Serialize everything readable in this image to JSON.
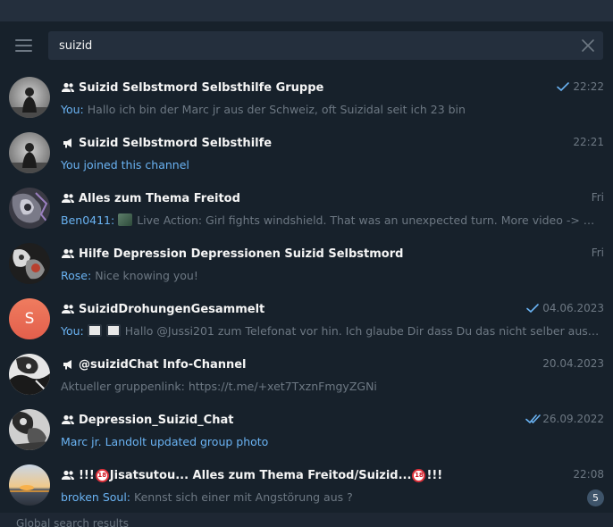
{
  "search": {
    "value": "suizid"
  },
  "chats": [
    {
      "type": "group",
      "title": "Suizid Selbstmord Selbsthilfe Gruppe",
      "time": "22:22",
      "status": "read",
      "sender": "You:",
      "message": "Hallo ich bin der Marc jr aus der Schweiz, oft Suizidal seit ich 23 bin"
    },
    {
      "type": "channel",
      "title": "Suizid Selbstmord Selbsthilfe",
      "time": "22:21",
      "service": "You joined this channel"
    },
    {
      "type": "group",
      "title": "Alles zum Thema Freitod",
      "time": "Fri",
      "sender": "Ben0411:",
      "message": "Live Action: Girl fights windshield.  That was an unexpected turn.  More video -> LiveLeak"
    },
    {
      "type": "group",
      "title": "Hilfe Depression Depressionen Suizid Selbstmord",
      "time": "Fri",
      "sender": "Rose:",
      "message": "Nice knowing you!"
    },
    {
      "type": "group",
      "title": "SuizidDrohungenGesammelt",
      "time": "04.06.2023",
      "status": "read",
      "avatar_letter": "S",
      "sender": "You:",
      "message": "Hallo @Jussi201   zum Telefonat vor hin. Ich glaube Dir dass Du das nicht selber ausgelöst hast. A"
    },
    {
      "type": "channel",
      "title": "@suizidChat Info-Channel",
      "time": "20.04.2023",
      "message": "Aktueller gruppenlink: https://t.me/+xet7TxznFmgyZGNi"
    },
    {
      "type": "group",
      "title": "Depression_Suizid_Chat",
      "time": "26.09.2022",
      "status": "read-double",
      "service": "Marc jr. Landolt updated group photo"
    },
    {
      "type": "group",
      "title_prefix": "!!!",
      "title_mid": "Jisatsutou... Alles zum Thema Freitod/Suizid...",
      "title_suffix": "!!!",
      "badge_18": "18",
      "time": "22:08",
      "sender": "broken Soul:",
      "message": "Kennst sich einer mit Angstörung aus ?",
      "unread": "5"
    }
  ],
  "footer": {
    "label": "Global search results"
  },
  "colors": {
    "background": "#17212b",
    "header": "#242f3d",
    "accent": "#6ab3f3",
    "muted": "#6d7883"
  }
}
